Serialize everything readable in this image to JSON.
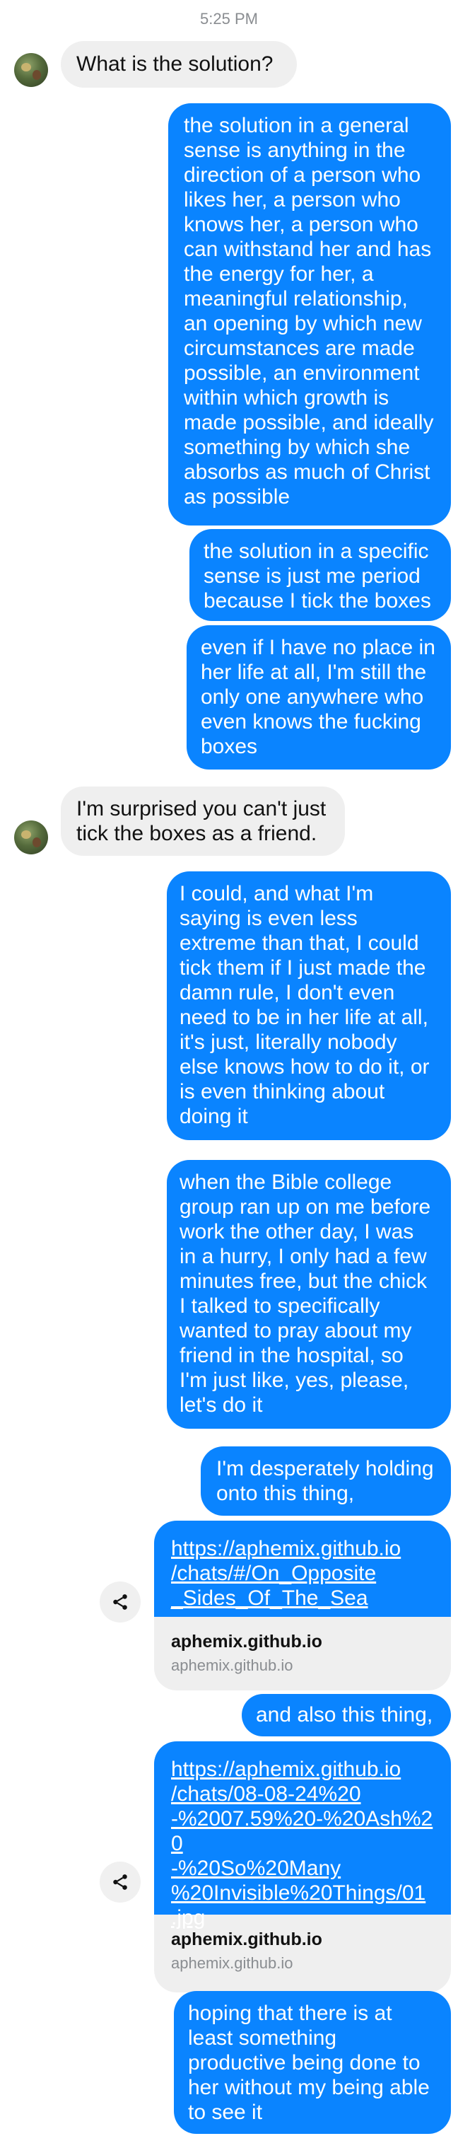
{
  "timestamp": "5:25 PM",
  "messages": [
    "What is the solution?",
    "the solution in a general\nsense is anything in the\ndirection of a person who\nlikes her, a person who\nknows her, a person who\ncan withstand her and has\nthe energy for her, a\nmeaningful relationship,\nan opening by which new\ncircumstances are made\npossible, an environment\nwithin which growth is\nmade possible, and ideally\nsomething by which she\nabsorbs as much of Christ\nas possible",
    "the solution in a specific\nsense is just me period\nbecause I tick the boxes",
    "even if I have no place in\nher life at all, I'm still the\nonly one anywhere who\neven knows the fucking\nboxes",
    "I'm surprised you can't just\ntick the boxes as a friend.",
    "I could, and what I'm\nsaying is even less\nextreme than that, I could\ntick them if I just made the\ndamn rule, I don't even\nneed to be in her life at all,\nit's just, literally nobody\nelse knows how to do it, or\nis even thinking about\ndoing it",
    "when the Bible college\ngroup ran up on me before\nwork the other day, I was\nin a hurry, I only had a few\nminutes free, but the chick\nI talked to specifically\nwanted to pray about my\nfriend in the hospital, so\nI'm just like, yes, please,\nlet's do it",
    "I'm desperately holding\nonto this thing,",
    "and also this thing,",
    "hoping that there is at\nleast something\nproductive being done to\nher without my being able\nto see it"
  ],
  "links": [
    {
      "url": "https://aphemix.github.io\n/chats/#/On_Opposite\n_Sides_Of_The_Sea",
      "title": "aphemix.github.io",
      "domain": "aphemix.github.io"
    },
    {
      "url": "https://aphemix.github.io\n/chats/08-08-24%20\n-%2007.59%20-%20Ash%20\n-%20So%20Many\n%20Invisible%20Things/01\n.jpg",
      "title": "aphemix.github.io",
      "domain": "aphemix.github.io"
    }
  ],
  "icons": {
    "avatar": "contact-avatar",
    "share": "share-icon"
  },
  "colors": {
    "outgoing": "#0a84ff",
    "incoming": "#efefef"
  }
}
